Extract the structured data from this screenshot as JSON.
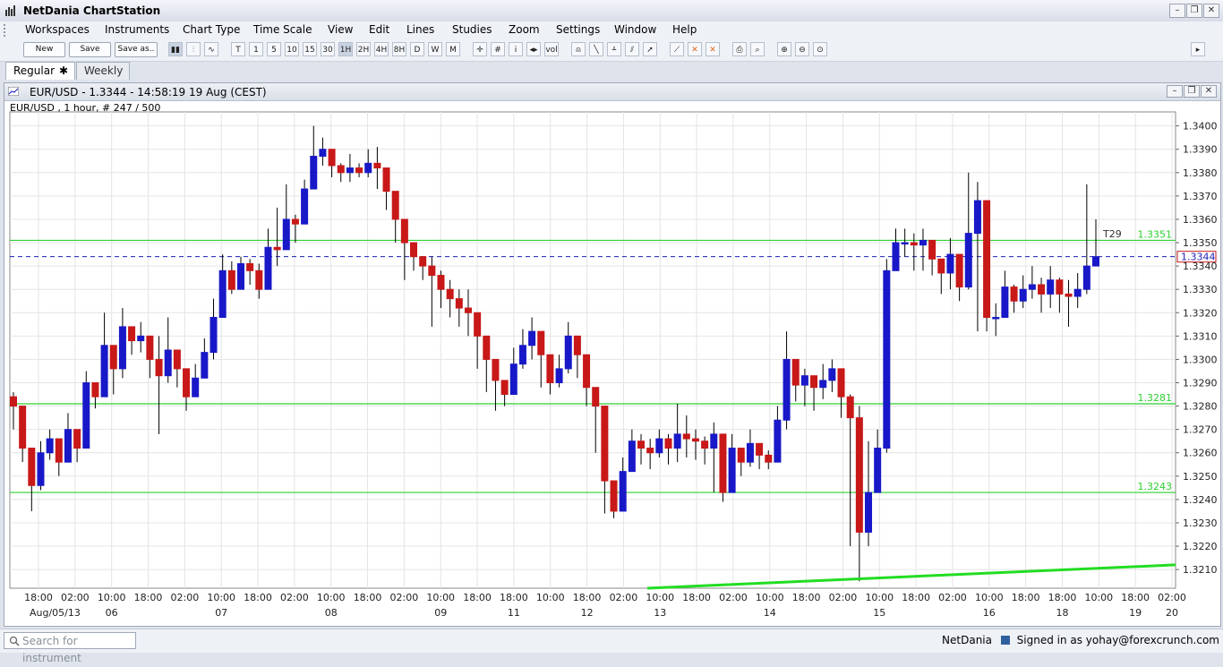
{
  "window": {
    "title": "NetDania ChartStation"
  },
  "menu": [
    "Workspaces",
    "Instruments",
    "Chart Type",
    "Time Scale",
    "View",
    "Edit",
    "Lines",
    "Studies",
    "Zoom",
    "Settings",
    "Window",
    "Help"
  ],
  "toolbar": {
    "new_label": "New",
    "save_label": "Save",
    "save_as_label": "Save as..",
    "scales": [
      "T",
      "1",
      "5",
      "10",
      "15",
      "30",
      "1H",
      "2H",
      "4H",
      "8H",
      "D",
      "W",
      "M"
    ],
    "active_scale": "1H"
  },
  "tabs": [
    {
      "label": "Regular",
      "active": true
    },
    {
      "label": "Weekly",
      "active": false
    }
  ],
  "chart_window": {
    "title": "EUR/USD - 1.3344 - 14:58:19  19 Aug (CEST)",
    "info": "EUR/USD , 1 hour, # 247 / 500"
  },
  "chart_data": {
    "type": "candlestick",
    "symbol": "EUR/USD",
    "ylim": [
      1.3202,
      1.3406
    ],
    "y_ticks": [
      "1.3400",
      "1.3390",
      "1.3380",
      "1.3370",
      "1.3360",
      "1.3350",
      "1.3340",
      "1.3330",
      "1.3320",
      "1.3310",
      "1.3300",
      "1.3290",
      "1.3280",
      "1.3270",
      "1.3260",
      "1.3250",
      "1.3240",
      "1.3230",
      "1.3220",
      "1.3210"
    ],
    "x_time_labels": [
      "18:00",
      "02:00",
      "10:00",
      "18:00",
      "02:00",
      "10:00",
      "18:00",
      "02:00",
      "10:00",
      "18:00",
      "02:00",
      "10:00",
      "18:00",
      "18:00",
      "10:00",
      "18:00",
      "02:00",
      "10:00",
      "18:00",
      "02:00",
      "10:00",
      "18:00",
      "02:00",
      "10:00",
      "18:00",
      "02:00",
      "10:00",
      "18:00",
      "18:00",
      "10:00",
      "18:00",
      "02:00"
    ],
    "x_date_labels": [
      "Aug/05/13",
      "06",
      "07",
      "08",
      "09",
      "11",
      "12",
      "13",
      "14",
      "15",
      "16",
      "18",
      "19",
      "20"
    ],
    "horizontal_lines": [
      {
        "value": 1.3351,
        "label": "1.3351",
        "color": "#2fcf2f"
      },
      {
        "value": 1.3281,
        "label": "1.3281",
        "color": "#2fcf2f"
      },
      {
        "value": 1.3243,
        "label": "1.3243",
        "color": "#2fcf2f"
      }
    ],
    "current_price": {
      "value": 1.3344,
      "label": "1.3344",
      "color": "#1d1db8"
    },
    "trendline": {
      "from_value": 1.3202,
      "to_value": 1.3212,
      "color": "#22dd22"
    },
    "annotation": "T29",
    "up_color": "#1818c8",
    "down_color": "#c81818",
    "close_path": [
      1.328,
      1.3262,
      1.3246,
      1.326,
      1.3266,
      1.3256,
      1.327,
      1.3262,
      1.329,
      1.3284,
      1.3306,
      1.3296,
      1.3314,
      1.3308,
      1.331,
      1.33,
      1.3293,
      1.3304,
      1.3296,
      1.3284,
      1.3292,
      1.3303,
      1.3318,
      1.3338,
      1.333,
      1.3341,
      1.3338,
      1.333,
      1.3348,
      1.3347,
      1.336,
      1.3358,
      1.3373,
      1.3387,
      1.339,
      1.3383,
      1.338,
      1.3382,
      1.338,
      1.3384,
      1.3382,
      1.3372,
      1.336,
      1.335,
      1.3344,
      1.334,
      1.3336,
      1.333,
      1.3326,
      1.3322,
      1.332,
      1.331,
      1.33,
      1.3291,
      1.3285,
      1.3298,
      1.3306,
      1.3312,
      1.3302,
      1.329,
      1.3296,
      1.331,
      1.3302,
      1.3288,
      1.328,
      1.3248,
      1.3235,
      1.3252,
      1.3265,
      1.3262,
      1.326,
      1.3266,
      1.3262,
      1.3268,
      1.3266,
      1.3265,
      1.3262,
      1.3268,
      1.3243,
      1.3262,
      1.3256,
      1.3264,
      1.3259,
      1.3256,
      1.3274,
      1.33,
      1.3289,
      1.3293,
      1.3288,
      1.3291,
      1.3296,
      1.3284,
      1.3275,
      1.3226,
      1.3243,
      1.3262,
      1.3338,
      1.335,
      1.335,
      1.3349,
      1.3351,
      1.3343,
      1.3337,
      1.3345,
      1.3331,
      1.3354,
      1.3368,
      1.3318,
      1.3318,
      1.3331,
      1.3325,
      1.333,
      1.3332,
      1.3328,
      1.3334,
      1.3328,
      1.3327,
      1.333,
      1.334,
      1.3344
    ],
    "high_path": [
      1.3286,
      1.3271,
      1.3255,
      1.3265,
      1.327,
      1.3262,
      1.3277,
      1.327,
      1.3295,
      1.329,
      1.332,
      1.3302,
      1.3322,
      1.3314,
      1.3316,
      1.3306,
      1.331,
      1.3318,
      1.33,
      1.3292,
      1.3298,
      1.3309,
      1.3326,
      1.3345,
      1.3342,
      1.3344,
      1.3343,
      1.3341,
      1.3356,
      1.3365,
      1.3375,
      1.3362,
      1.3377,
      1.34,
      1.3395,
      1.339,
      1.3384,
      1.3388,
      1.3384,
      1.339,
      1.3391,
      1.338,
      1.3368,
      1.3356,
      1.3348,
      1.3344,
      1.3344,
      1.3338,
      1.3334,
      1.333,
      1.333,
      1.3314,
      1.3306,
      1.3296,
      1.3288,
      1.3305,
      1.3313,
      1.3318,
      1.3308,
      1.3294,
      1.3302,
      1.3316,
      1.3306,
      1.3292,
      1.3288,
      1.3265,
      1.3242,
      1.3258,
      1.327,
      1.3268,
      1.3266,
      1.327,
      1.3268,
      1.3281,
      1.3276,
      1.327,
      1.3267,
      1.3273,
      1.3249,
      1.3268,
      1.3262,
      1.327,
      1.3264,
      1.3261,
      1.328,
      1.3312,
      1.3294,
      1.3296,
      1.3293,
      1.3298,
      1.33,
      1.329,
      1.3285,
      1.328,
      1.3265,
      1.327,
      1.3343,
      1.3356,
      1.3356,
      1.3354,
      1.3356,
      1.3348,
      1.3343,
      1.3352,
      1.334,
      1.338,
      1.3376,
      1.333,
      1.3324,
      1.3338,
      1.3332,
      1.3336,
      1.334,
      1.3335,
      1.334,
      1.3335,
      1.3334,
      1.3337,
      1.3375,
      1.336
    ],
    "low_path": [
      1.327,
      1.3256,
      1.3235,
      1.3244,
      1.3257,
      1.325,
      1.3256,
      1.3256,
      1.3272,
      1.3279,
      1.3296,
      1.3285,
      1.3292,
      1.3302,
      1.3303,
      1.3292,
      1.3268,
      1.329,
      1.3288,
      1.3278,
      1.3285,
      1.3293,
      1.33,
      1.3318,
      1.3328,
      1.333,
      1.3332,
      1.3326,
      1.333,
      1.334,
      1.3347,
      1.335,
      1.336,
      1.3373,
      1.3383,
      1.3378,
      1.3376,
      1.3376,
      1.3378,
      1.3378,
      1.3373,
      1.3364,
      1.335,
      1.3334,
      1.3338,
      1.3334,
      1.3314,
      1.3322,
      1.3318,
      1.3314,
      1.331,
      1.3296,
      1.3286,
      1.3278,
      1.328,
      1.3288,
      1.3296,
      1.33,
      1.3288,
      1.3285,
      1.3288,
      1.3294,
      1.3292,
      1.328,
      1.326,
      1.3234,
      1.3232,
      1.3238,
      1.3256,
      1.3255,
      1.3253,
      1.3258,
      1.3255,
      1.3256,
      1.3258,
      1.3257,
      1.3255,
      1.3243,
      1.3239,
      1.3244,
      1.325,
      1.3254,
      1.3253,
      1.3253,
      1.3268,
      1.327,
      1.3282,
      1.328,
      1.3278,
      1.3283,
      1.3286,
      1.3275,
      1.322,
      1.3205,
      1.322,
      1.3256,
      1.326,
      1.334,
      1.3344,
      1.3338,
      1.3338,
      1.3336,
      1.3328,
      1.333,
      1.3325,
      1.333,
      1.3312,
      1.3312,
      1.331,
      1.3318,
      1.332,
      1.3322,
      1.3326,
      1.332,
      1.3322,
      1.332,
      1.3314,
      1.3322,
      1.3328,
      1.334
    ]
  },
  "status": {
    "search_placeholder": "Search for instrument",
    "brand": "NetDania",
    "signed_in": "Signed in as yohay@forexcrunch.com"
  }
}
